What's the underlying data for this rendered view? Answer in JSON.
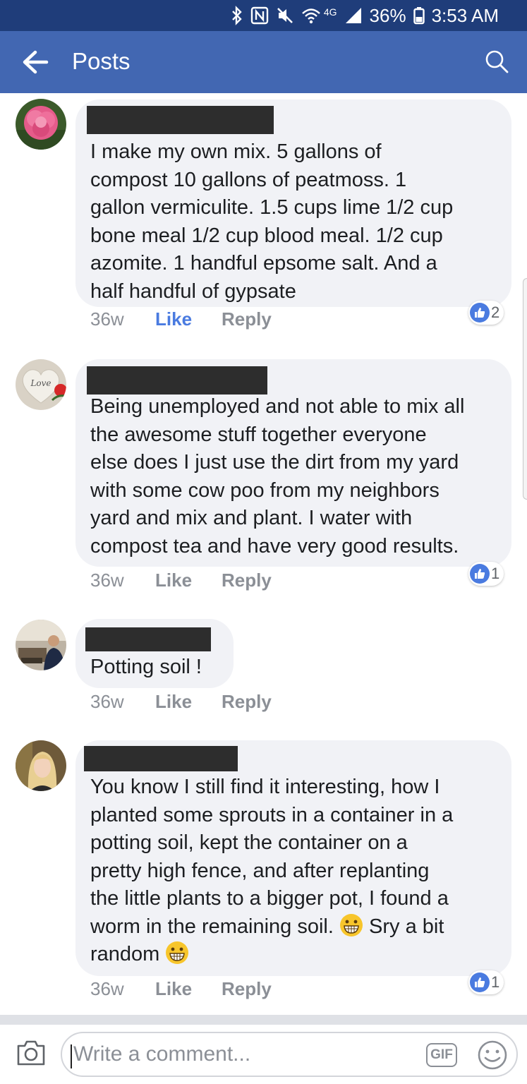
{
  "status_bar": {
    "battery": "36%",
    "time": "3:53 AM",
    "network": "4G",
    "icons": [
      "bluetooth-icon",
      "nfc-icon",
      "mute-icon",
      "wifi-icon",
      "signal-icon",
      "battery-icon"
    ]
  },
  "app_bar": {
    "title": "Posts",
    "back_icon": "back-arrow-icon",
    "search_icon": "search-icon"
  },
  "comments": [
    {
      "avatar": "flower-avatar",
      "text": "I make my own mix. 5 gallons of\ncompost 10 gallons of peatmoss. 1\ngallon vermiculite. 1.5 cups lime 1/2 cup\nbone meal 1/2 cup blood meal. 1/2 cup\nazomite. 1 handful epsome salt. And a\nhalf handful of gypsate",
      "time": "36w",
      "like": "Like",
      "reply": "Reply",
      "reactions": "2",
      "liked": true
    },
    {
      "avatar": "heart-stone-avatar",
      "avatar_text": "Love",
      "text": "Being unemployed and not able to mix all\nthe awesome stuff together everyone\nelse does I just use the dirt from my yard\nwith some cow poo from my neighbors\nyard and mix and plant. I water with\ncompost tea and have very good results.",
      "time": "36w",
      "like": "Like",
      "reply": "Reply",
      "reactions": "1",
      "liked": false
    },
    {
      "avatar": "person-avatar",
      "text": "Potting soil !",
      "time": "36w",
      "like": "Like",
      "reply": "Reply",
      "liked": false
    },
    {
      "avatar": "blonde-person-avatar",
      "text_lines": [
        "You know I still find it interesting, how I",
        "planted some sprouts in a container in a",
        "potting soil, kept the container on a",
        "pretty high fence, and after replanting",
        "the little plants to a bigger pot, I found a",
        "worm in the remaining soil.",
        " Sry a bit",
        "random"
      ],
      "emoji": "grinning-face-emoji",
      "time": "36w",
      "like": "Like",
      "reply": "Reply",
      "reactions": "1",
      "liked": false
    }
  ],
  "composer": {
    "placeholder": "Write a comment...",
    "gif_label": "GIF",
    "camera_icon": "camera-icon",
    "emoji_icon": "smiley-icon"
  },
  "colors": {
    "status_bar": "#1f3d7a",
    "app_bar": "#4267b2",
    "like_active": "#4a7be0",
    "bubble": "#f1f2f6",
    "meta_text": "#8b8f96"
  }
}
